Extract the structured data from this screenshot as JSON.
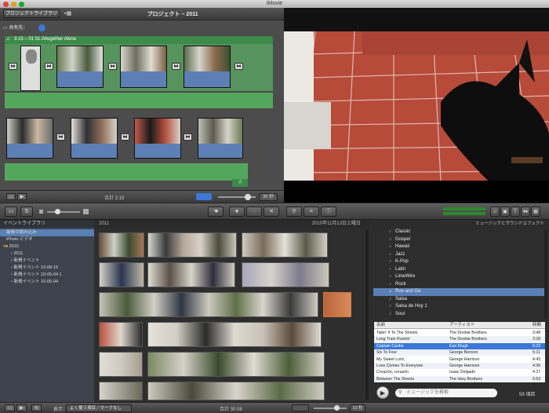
{
  "window": {
    "title": "iMovie"
  },
  "project_bar": {
    "library_button": "プロジェクトライブラリ",
    "title": "プロジェクト – 2011"
  },
  "project": {
    "share_label": "共有先：",
    "clip_title": "3:15 – 01 01.Altogether Alone",
    "total": "合計 3:15",
    "duration_label": "30 秒"
  },
  "event_library": {
    "header": "イベントライブラリ",
    "items": [
      "最後の読み込み",
      "iPhoto ビデオ",
      "2010",
      "2011",
      "新規イベント",
      "新規イベント 10-08-15",
      "新規イベント 10-05-04 1",
      "新規イベント 10-05-04"
    ]
  },
  "browser": {
    "year": "2011",
    "date": "2010年11月13日土曜日",
    "total": "合計 30:08",
    "duration_label": "10 秒"
  },
  "bottom": {
    "show_label": "表示：",
    "show_value": "よく使う項目／マークなし"
  },
  "music": {
    "header": "ミュージックとサウンドエフェクト",
    "genres": [
      "Classic",
      "Gospel",
      "Hawaii",
      "Jazz",
      "K-Pop",
      "Latin",
      "LimeWire",
      "Rock",
      "Run and Go",
      "Salsa",
      "Salsa de Hoy 1",
      "Soul"
    ],
    "selected_genre": "Run and Go",
    "columns": {
      "name": "名前",
      "artist": "アーティスト",
      "time": "時間"
    },
    "songs": [
      {
        "name": "Takin' It To The Streets",
        "artist": "The Doobie Brothers",
        "time": "3:48"
      },
      {
        "name": "Long Train Runnin'",
        "artist": "The Doobie Brothers",
        "time": "3:28"
      },
      {
        "name": "Captain Caribe",
        "artist": "Earl Klugh",
        "time": "5:23"
      },
      {
        "name": "Six To Four",
        "artist": "George Benson",
        "time": "5:11"
      },
      {
        "name": "My Sweet Lord",
        "artist": "George Harrison",
        "time": "4:43"
      },
      {
        "name": "Love Comes To Everyone",
        "artist": "George Harrison",
        "time": "4:36"
      },
      {
        "name": "Corazón, corazón",
        "artist": "Isaac Delgado",
        "time": "4:27"
      },
      {
        "name": "Between The Sheets",
        "artist": "The Isley Brothers",
        "time": "5:53"
      }
    ],
    "selected_song": 2,
    "search_placeholder": "ミュージックを検索",
    "count": "59 項目"
  },
  "colors": {
    "accent": "#3b78d8",
    "project_green": "#3c8b4a",
    "audio_blue": "#5d7fb3"
  }
}
